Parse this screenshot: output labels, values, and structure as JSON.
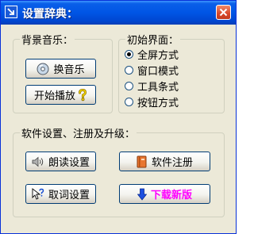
{
  "window": {
    "title": "设置辞典："
  },
  "music_group": {
    "title": "背景音乐：",
    "change_music_button": "换音乐",
    "start_play_button": "开始播放"
  },
  "interface_group": {
    "title": "初始界面：",
    "options": [
      {
        "label": "全屏方式",
        "checked": true
      },
      {
        "label": "窗口模式",
        "checked": false
      },
      {
        "label": "工具条式",
        "checked": false
      },
      {
        "label": "按钮方式",
        "checked": false
      }
    ]
  },
  "software_group": {
    "title": "软件设置、注册及升级：",
    "read_settings_button": "朗读设置",
    "register_button": "软件注册",
    "word_pick_button": "取词设置",
    "download_button": "下载新版"
  },
  "colors": {
    "download_text": "#ff00ff",
    "titlebar": "#0055e5"
  },
  "icons": {
    "window": "restore-arrow-icon",
    "close": "close-icon",
    "change_music": "cd-icon",
    "start_play": "question-mark-icon",
    "read_settings": "speaker-icon",
    "register": "book-icon",
    "word_pick": "cursor-question-icon",
    "download": "down-arrow-icon"
  }
}
